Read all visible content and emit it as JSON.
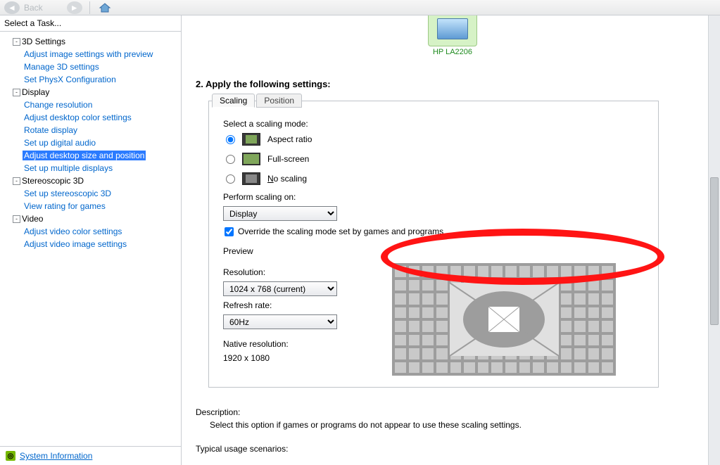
{
  "toolbar": {
    "back": "Back"
  },
  "sidebar": {
    "header": "Select a Task...",
    "groups": [
      {
        "label": "3D Settings",
        "items": [
          "Adjust image settings with preview",
          "Manage 3D settings",
          "Set PhysX Configuration"
        ]
      },
      {
        "label": "Display",
        "items": [
          "Change resolution",
          "Adjust desktop color settings",
          "Rotate display",
          "Set up digital audio",
          "Adjust desktop size and position",
          "Set up multiple displays"
        ],
        "selected": 4
      },
      {
        "label": "Stereoscopic 3D",
        "items": [
          "Set up stereoscopic 3D",
          "View rating for games"
        ]
      },
      {
        "label": "Video",
        "items": [
          "Adjust video color settings",
          "Adjust video image settings"
        ]
      }
    ],
    "sysinfo": "System Information"
  },
  "main": {
    "monitor": "HP LA2206",
    "step2": "2. Apply the following settings:",
    "tabs": [
      "Scaling",
      "Position"
    ],
    "scaling": {
      "select_mode": "Select a scaling mode:",
      "modes": [
        "Aspect ratio",
        "Full-screen",
        "No scaling"
      ],
      "selected_mode": 0,
      "perform_on_label": "Perform scaling on:",
      "perform_on_value": "Display",
      "override": "Override the scaling mode set by games and programs",
      "override_checked": true,
      "preview_header": "Preview",
      "resolution_label": "Resolution:",
      "resolution_value": "1024 x 768 (current)",
      "refresh_label": "Refresh rate:",
      "refresh_value": "60Hz",
      "native_label": "Native resolution:",
      "native_value": "1920 x 1080"
    },
    "description": {
      "h": "Description:",
      "t": "Select this option if games or programs do not appear to use these scaling settings."
    },
    "scenarios": {
      "h": "Typical usage scenarios:"
    }
  }
}
